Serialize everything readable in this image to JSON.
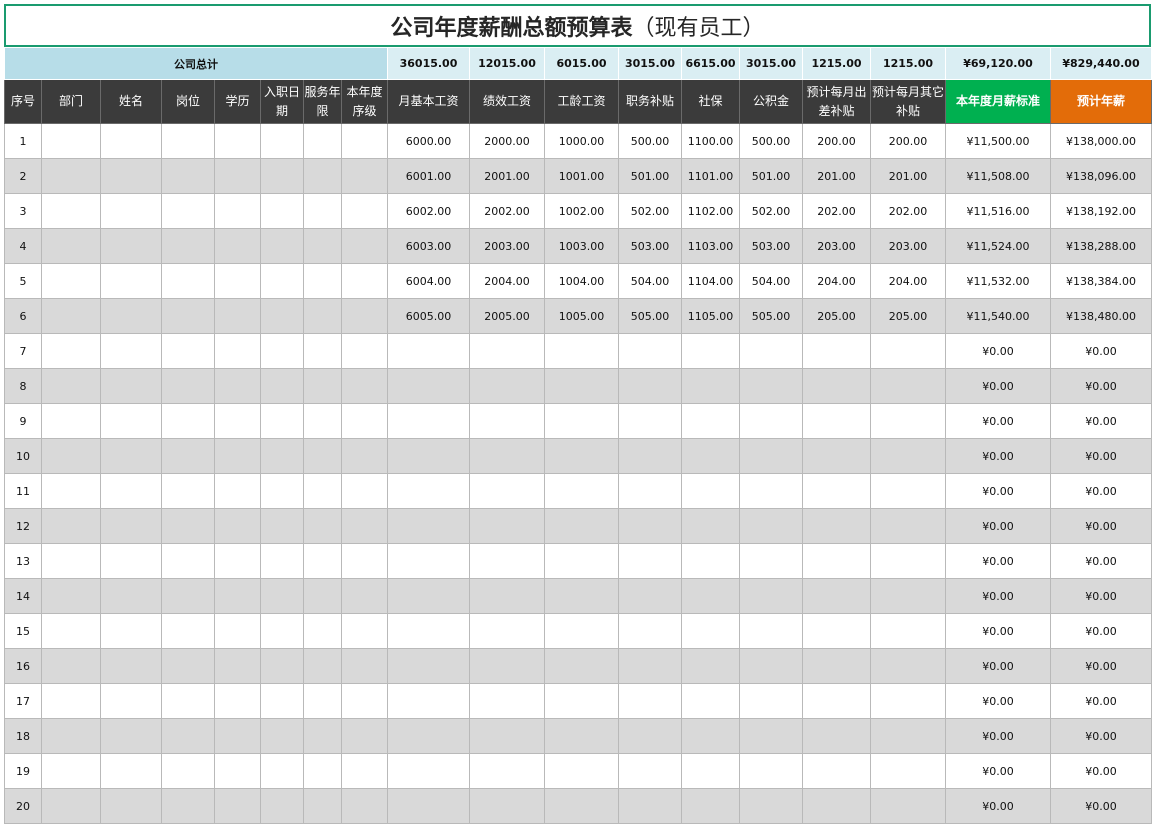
{
  "title_main": "公司年度薪酬总额预算表",
  "title_sub": "（现有员工）",
  "summary": {
    "label": "公司总计",
    "values": [
      "36015.00",
      "12015.00",
      "6015.00",
      "3015.00",
      "6615.00",
      "3015.00",
      "1215.00",
      "1215.00",
      "¥69,120.00",
      "¥829,440.00"
    ]
  },
  "headers": [
    "序号",
    "部门",
    "姓名",
    "岗位",
    "学历",
    "入职日期",
    "服务年限",
    "本年度序级",
    "月基本工资",
    "绩效工资",
    "工龄工资",
    "职务补贴",
    "社保",
    "公积金",
    "预计每月出差补贴",
    "预计每月其它补贴",
    "本年度月薪标准",
    "预计年薪"
  ],
  "colors": {
    "header_bg": "#3b3b3b",
    "summary_bg": "#b7dde8",
    "monthly_header": "#00b050",
    "annual_header": "#e36c09",
    "title_border": "#1a9b6f",
    "stripe": "#d9d9d9"
  },
  "rows": [
    [
      "1",
      "",
      "",
      "",
      "",
      "",
      "",
      "",
      "6000.00",
      "2000.00",
      "1000.00",
      "500.00",
      "1100.00",
      "500.00",
      "200.00",
      "200.00",
      "¥11,500.00",
      "¥138,000.00"
    ],
    [
      "2",
      "",
      "",
      "",
      "",
      "",
      "",
      "",
      "6001.00",
      "2001.00",
      "1001.00",
      "501.00",
      "1101.00",
      "501.00",
      "201.00",
      "201.00",
      "¥11,508.00",
      "¥138,096.00"
    ],
    [
      "3",
      "",
      "",
      "",
      "",
      "",
      "",
      "",
      "6002.00",
      "2002.00",
      "1002.00",
      "502.00",
      "1102.00",
      "502.00",
      "202.00",
      "202.00",
      "¥11,516.00",
      "¥138,192.00"
    ],
    [
      "4",
      "",
      "",
      "",
      "",
      "",
      "",
      "",
      "6003.00",
      "2003.00",
      "1003.00",
      "503.00",
      "1103.00",
      "503.00",
      "203.00",
      "203.00",
      "¥11,524.00",
      "¥138,288.00"
    ],
    [
      "5",
      "",
      "",
      "",
      "",
      "",
      "",
      "",
      "6004.00",
      "2004.00",
      "1004.00",
      "504.00",
      "1104.00",
      "504.00",
      "204.00",
      "204.00",
      "¥11,532.00",
      "¥138,384.00"
    ],
    [
      "6",
      "",
      "",
      "",
      "",
      "",
      "",
      "",
      "6005.00",
      "2005.00",
      "1005.00",
      "505.00",
      "1105.00",
      "505.00",
      "205.00",
      "205.00",
      "¥11,540.00",
      "¥138,480.00"
    ],
    [
      "7",
      "",
      "",
      "",
      "",
      "",
      "",
      "",
      "",
      "",
      "",
      "",
      "",
      "",
      "",
      "",
      "¥0.00",
      "¥0.00"
    ],
    [
      "8",
      "",
      "",
      "",
      "",
      "",
      "",
      "",
      "",
      "",
      "",
      "",
      "",
      "",
      "",
      "",
      "¥0.00",
      "¥0.00"
    ],
    [
      "9",
      "",
      "",
      "",
      "",
      "",
      "",
      "",
      "",
      "",
      "",
      "",
      "",
      "",
      "",
      "",
      "¥0.00",
      "¥0.00"
    ],
    [
      "10",
      "",
      "",
      "",
      "",
      "",
      "",
      "",
      "",
      "",
      "",
      "",
      "",
      "",
      "",
      "",
      "¥0.00",
      "¥0.00"
    ],
    [
      "11",
      "",
      "",
      "",
      "",
      "",
      "",
      "",
      "",
      "",
      "",
      "",
      "",
      "",
      "",
      "",
      "¥0.00",
      "¥0.00"
    ],
    [
      "12",
      "",
      "",
      "",
      "",
      "",
      "",
      "",
      "",
      "",
      "",
      "",
      "",
      "",
      "",
      "",
      "¥0.00",
      "¥0.00"
    ],
    [
      "13",
      "",
      "",
      "",
      "",
      "",
      "",
      "",
      "",
      "",
      "",
      "",
      "",
      "",
      "",
      "",
      "¥0.00",
      "¥0.00"
    ],
    [
      "14",
      "",
      "",
      "",
      "",
      "",
      "",
      "",
      "",
      "",
      "",
      "",
      "",
      "",
      "",
      "",
      "¥0.00",
      "¥0.00"
    ],
    [
      "15",
      "",
      "",
      "",
      "",
      "",
      "",
      "",
      "",
      "",
      "",
      "",
      "",
      "",
      "",
      "",
      "¥0.00",
      "¥0.00"
    ],
    [
      "16",
      "",
      "",
      "",
      "",
      "",
      "",
      "",
      "",
      "",
      "",
      "",
      "",
      "",
      "",
      "",
      "¥0.00",
      "¥0.00"
    ],
    [
      "17",
      "",
      "",
      "",
      "",
      "",
      "",
      "",
      "",
      "",
      "",
      "",
      "",
      "",
      "",
      "",
      "¥0.00",
      "¥0.00"
    ],
    [
      "18",
      "",
      "",
      "",
      "",
      "",
      "",
      "",
      "",
      "",
      "",
      "",
      "",
      "",
      "",
      "",
      "¥0.00",
      "¥0.00"
    ],
    [
      "19",
      "",
      "",
      "",
      "",
      "",
      "",
      "",
      "",
      "",
      "",
      "",
      "",
      "",
      "",
      "",
      "¥0.00",
      "¥0.00"
    ],
    [
      "20",
      "",
      "",
      "",
      "",
      "",
      "",
      "",
      "",
      "",
      "",
      "",
      "",
      "",
      "",
      "",
      "¥0.00",
      "¥0.00"
    ]
  ]
}
